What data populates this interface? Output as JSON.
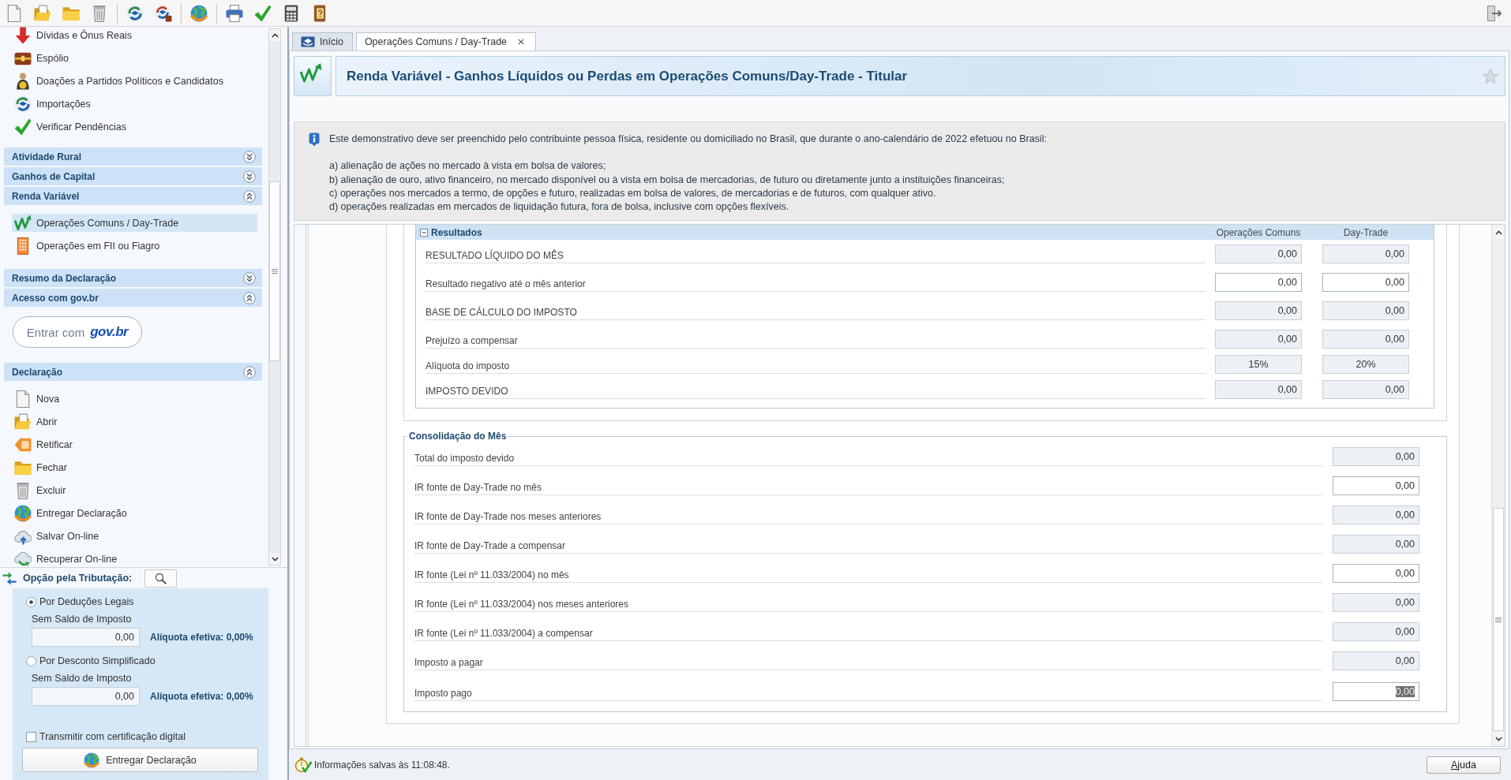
{
  "sidebar": {
    "leading_items": [
      {
        "label": "Dívidas e Ônus Reais",
        "selected": false
      },
      {
        "label": "Espólio",
        "selected": false
      },
      {
        "label": "Doações a Partidos Políticos e Candidatos",
        "selected": false
      },
      {
        "label": "Importações",
        "selected": false
      },
      {
        "label": "Verificar Pendências",
        "selected": false
      }
    ],
    "sections": [
      {
        "title": "Atividade Rural",
        "expanded": false
      },
      {
        "title": "Ganhos de Capital",
        "expanded": false
      },
      {
        "title": "Renda Variável",
        "expanded": true,
        "kind": "menu",
        "items": [
          {
            "label": "Operações Comuns / Day-Trade",
            "selected": true
          },
          {
            "label": "Operações em FII ou Fiagro",
            "selected": false
          }
        ]
      },
      {
        "title": "Resumo da Declaração",
        "expanded": false
      },
      {
        "title": "Acesso com gov.br",
        "expanded": true,
        "kind": "login",
        "login_button": {
          "label": "Entrar com",
          "logo": "gov.br"
        }
      },
      {
        "title": "Declaração",
        "expanded": true,
        "kind": "menu",
        "items": [
          {
            "label": "Nova",
            "selected": false
          },
          {
            "label": "Abrir",
            "selected": false
          },
          {
            "label": "Retificar",
            "selected": false
          },
          {
            "label": "Fechar",
            "selected": false
          },
          {
            "label": "Excluir",
            "selected": false
          },
          {
            "label": "Entregar Declaração",
            "selected": false
          },
          {
            "label": "Salvar On-line",
            "selected": false
          },
          {
            "label": "Recuperar On-line",
            "selected": false
          }
        ]
      }
    ]
  },
  "tax_option": {
    "title": "Opção pela Tributação:",
    "options": [
      {
        "label": "Por Deduções Legais",
        "selected": true,
        "caption": "Sem Saldo de Imposto",
        "value": "0,00",
        "rate": "Alíquota efetiva: 0,00%"
      },
      {
        "label": "Por Desconto Simplificado",
        "selected": false,
        "caption": "Sem Saldo de Imposto",
        "value": "0,00",
        "rate": "Alíquota efetiva: 0,00%"
      }
    ],
    "certificate": {
      "label": "Transmitir com certificação digital",
      "checked": false
    },
    "submit_button": "Entregar Declaração"
  },
  "tabs": [
    {
      "label": "Início",
      "selected": false,
      "closable": false
    },
    {
      "label": "Operações Comuns / Day-Trade",
      "selected": true,
      "closable": true
    }
  ],
  "page_header": {
    "title": "Renda Variável - Ganhos Líquidos ou Perdas em Operações Comuns/Day-Trade - Titular",
    "favorite": false
  },
  "notice": {
    "intro": "Este demonstrativo deve ser preenchido pelo contribuinte pessoa física, residente ou domiciliado no Brasil, que durante o ano-calendário de 2022 efetuou no Brasil:",
    "items": [
      "a) alienação de ações no mercado à vista em bolsa de valores;",
      "b) alienação de ouro, ativo financeiro, no mercado disponível ou à vista em bolsa de mercadorias, de futuro ou diretamente junto a instituições financeiras;",
      "c) operações nos mercados a termo, de opções e futuro, realizadas em bolsa de valores, de mercadorias e de futuros, com qualquer ativo.",
      "d) operações realizadas em mercados de liquidação futura, fora de bolsa, inclusive com opções flexíveis."
    ]
  },
  "results": {
    "title": "Resultados",
    "columns": [
      "Operações Comuns",
      "Day-Trade"
    ],
    "rows": [
      {
        "label": "RESULTADO LÍQUIDO DO MÊS",
        "kind": "amount",
        "cells": [
          {
            "value": "0,00",
            "editable": false
          },
          {
            "value": "0,00",
            "editable": false
          }
        ]
      },
      {
        "label": "Resultado negativo até o mês anterior",
        "kind": "amount",
        "cells": [
          {
            "value": "0,00",
            "editable": true
          },
          {
            "value": "0,00",
            "editable": true
          }
        ]
      },
      {
        "label": "BASE DE CÁLCULO DO IMPOSTO",
        "kind": "amount",
        "cells": [
          {
            "value": "0,00",
            "editable": false
          },
          {
            "value": "0,00",
            "editable": false
          }
        ]
      },
      {
        "label": "Prejuízo a compensar",
        "kind": "amount",
        "cells": [
          {
            "value": "0,00",
            "editable": false
          },
          {
            "value": "0,00",
            "editable": false
          }
        ]
      },
      {
        "label": "Alíquota do imposto",
        "kind": "rate",
        "cells": [
          {
            "value": "15%",
            "editable": false
          },
          {
            "value": "20%",
            "editable": false
          }
        ]
      },
      {
        "label": "IMPOSTO DEVIDO",
        "kind": "amount",
        "cells": [
          {
            "value": "0,00",
            "editable": false
          },
          {
            "value": "0,00",
            "editable": false
          }
        ]
      }
    ]
  },
  "consolidation": {
    "title": "Consolidação do Mês",
    "rows": [
      {
        "label": "Total do imposto devido",
        "value": "0,00",
        "editable": false,
        "focused": false
      },
      {
        "label": "IR fonte de Day-Trade no mês",
        "value": "0,00",
        "editable": true,
        "focused": false
      },
      {
        "label": "IR fonte de Day-Trade nos meses anteriores",
        "value": "0,00",
        "editable": false,
        "focused": false
      },
      {
        "label": "IR fonte de Day-Trade a compensar",
        "value": "0,00",
        "editable": false,
        "focused": false
      },
      {
        "label": "IR fonte (Lei nº 11.033/2004) no mês",
        "value": "0,00",
        "editable": true,
        "focused": false
      },
      {
        "label": "IR fonte (Lei nº 11.033/2004) nos meses anteriores",
        "value": "0,00",
        "editable": false,
        "focused": false
      },
      {
        "label": "IR fonte (Lei nº 11.033/2004) a compensar",
        "value": "0,00",
        "editable": false,
        "focused": false
      },
      {
        "label": "Imposto a pagar",
        "value": "0,00",
        "editable": false,
        "focused": false
      },
      {
        "label": "Imposto pago",
        "value": "0,00",
        "editable": true,
        "focused": true
      }
    ]
  },
  "status_bar": {
    "message": "Informações salvas às 11:08:48.",
    "help_button": "Ajuda"
  }
}
